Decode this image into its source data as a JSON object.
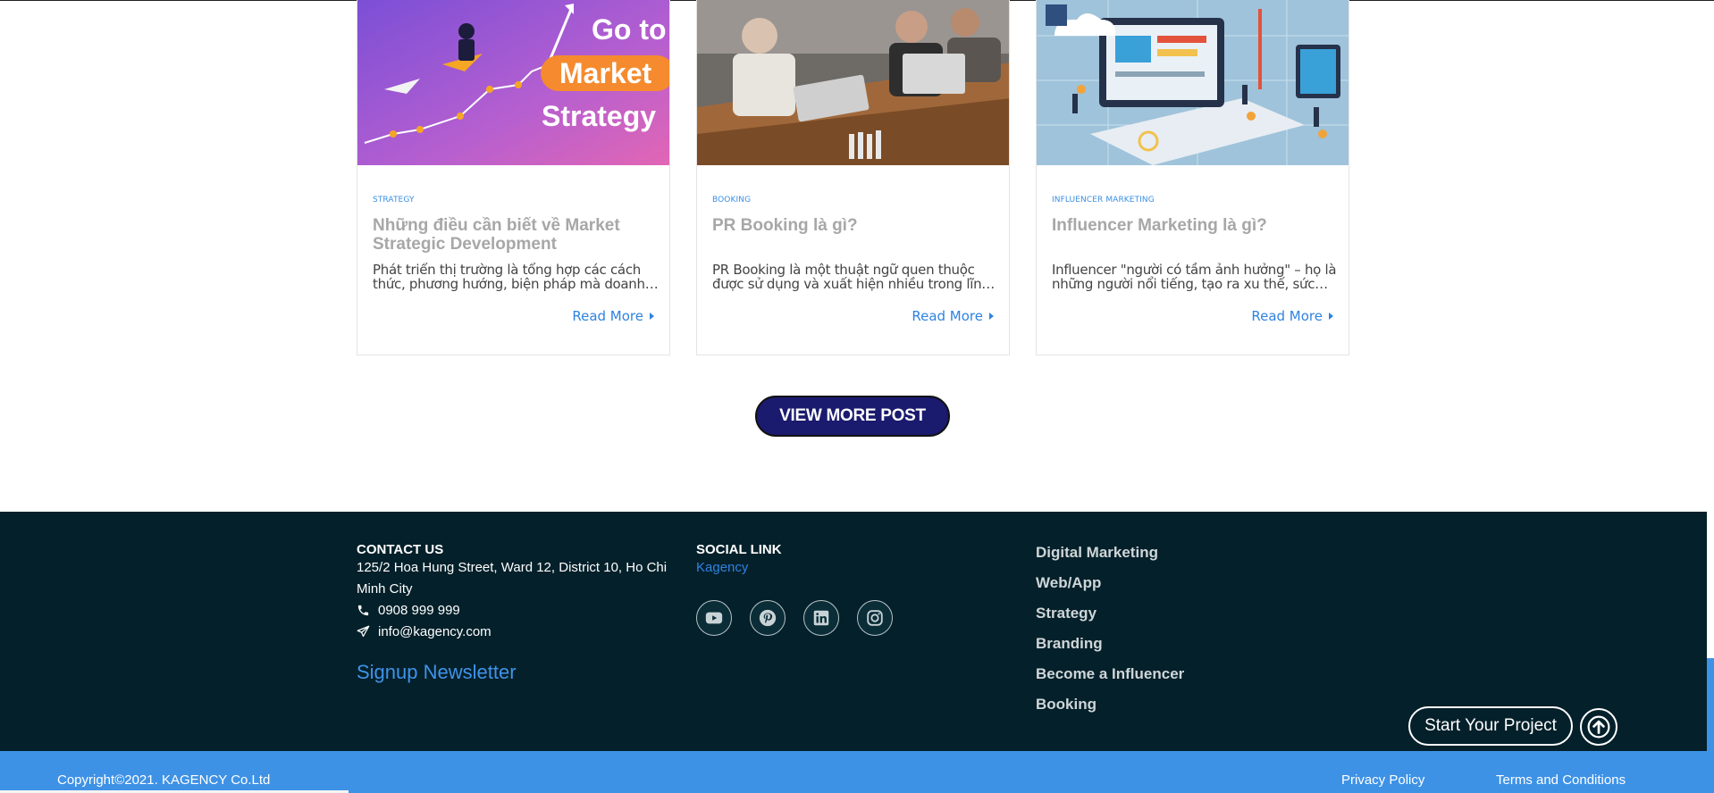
{
  "posts": [
    {
      "category": "STRATEGY",
      "title": "Những điều cần biết về Market Strategic Development",
      "excerpt": "Phát triển thị trường là tổng hợp các cách thức, phương hướng, biện pháp mà doanh nghiệp...",
      "read_more": "Read More",
      "image_text": [
        "Go to",
        "Market",
        "Strategy"
      ]
    },
    {
      "category": "BOOKING",
      "title": "PR Booking là gì?",
      "excerpt": "PR Booking là một thuật ngữ quen thuộc được sử dụng và xuất hiện nhiều trong lĩnh vực...",
      "read_more": "Read More"
    },
    {
      "category": "INFLUENCER MARKETING",
      "title": "Influencer Marketing là gì?",
      "excerpt": "Influencer \"người có tầm ảnh hưởng\" – họ là những người nổi tiếng, tạo ra xu thế, sức ảnh...",
      "read_more": "Read More"
    }
  ],
  "view_more_label": "VIEW MORE POST",
  "footer": {
    "contact": {
      "heading": "CONTACT US",
      "address": "125/2 Hoa Hung Street, Ward 12, District 10, Ho Chi Minh City",
      "phone": "0908 999 999",
      "email": "info@kagency.com",
      "phone_icon": "phone-icon",
      "email_icon": "paper-plane-icon"
    },
    "signup_label": "Signup Newsletter",
    "social": {
      "heading": "SOCIAL LINK",
      "brand": "Kagency",
      "icons": [
        "youtube-icon",
        "pinterest-icon",
        "linkedin-icon",
        "instagram-icon"
      ]
    },
    "links": [
      "Digital Marketing",
      "Web/App",
      "Strategy",
      "Branding",
      "Become a Influencer",
      "Booking"
    ],
    "start_project_label": "Start Your Project",
    "copyright": "Copyright©2021. KAGENCY Co.Ltd",
    "privacy": "Privacy Policy",
    "terms": "Terms and Conditions"
  },
  "colors": {
    "footer_bg": "#04202a",
    "accent_blue": "#3e92e6",
    "button_navy": "#1a1a6e"
  }
}
